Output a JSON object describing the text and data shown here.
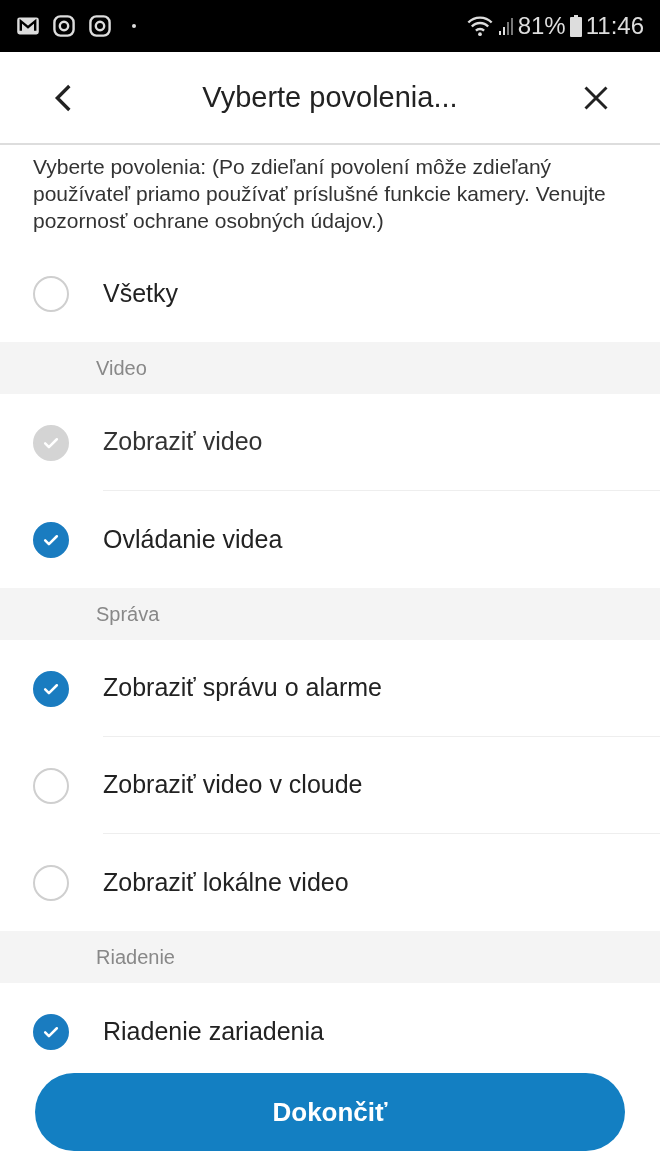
{
  "status_bar": {
    "battery": "81%",
    "time": "11:46"
  },
  "header": {
    "title": "Vyberte povolenia..."
  },
  "description": "Vyberte povolenia: (Po zdieľaní povolení môže zdieľaný používateľ priamo používať príslušné funkcie kamery. Venujte pozornosť ochrane osobných údajov.)",
  "all": {
    "label": "Všetky",
    "checked": false,
    "disabled": false
  },
  "sections": [
    {
      "title": "Video",
      "items": [
        {
          "label": "Zobraziť video",
          "checked": true,
          "disabled": true
        },
        {
          "label": "Ovládanie videa",
          "checked": true,
          "disabled": false
        }
      ]
    },
    {
      "title": "Správa",
      "items": [
        {
          "label": "Zobraziť správu o alarme",
          "checked": true,
          "disabled": false
        },
        {
          "label": "Zobraziť video v cloude",
          "checked": false,
          "disabled": false
        },
        {
          "label": "Zobraziť lokálne video",
          "checked": false,
          "disabled": false
        }
      ]
    },
    {
      "title": "Riadenie",
      "items": [
        {
          "label": "Riadenie zariadenia",
          "checked": true,
          "disabled": false
        }
      ]
    }
  ],
  "finish_button": "Dokončiť"
}
